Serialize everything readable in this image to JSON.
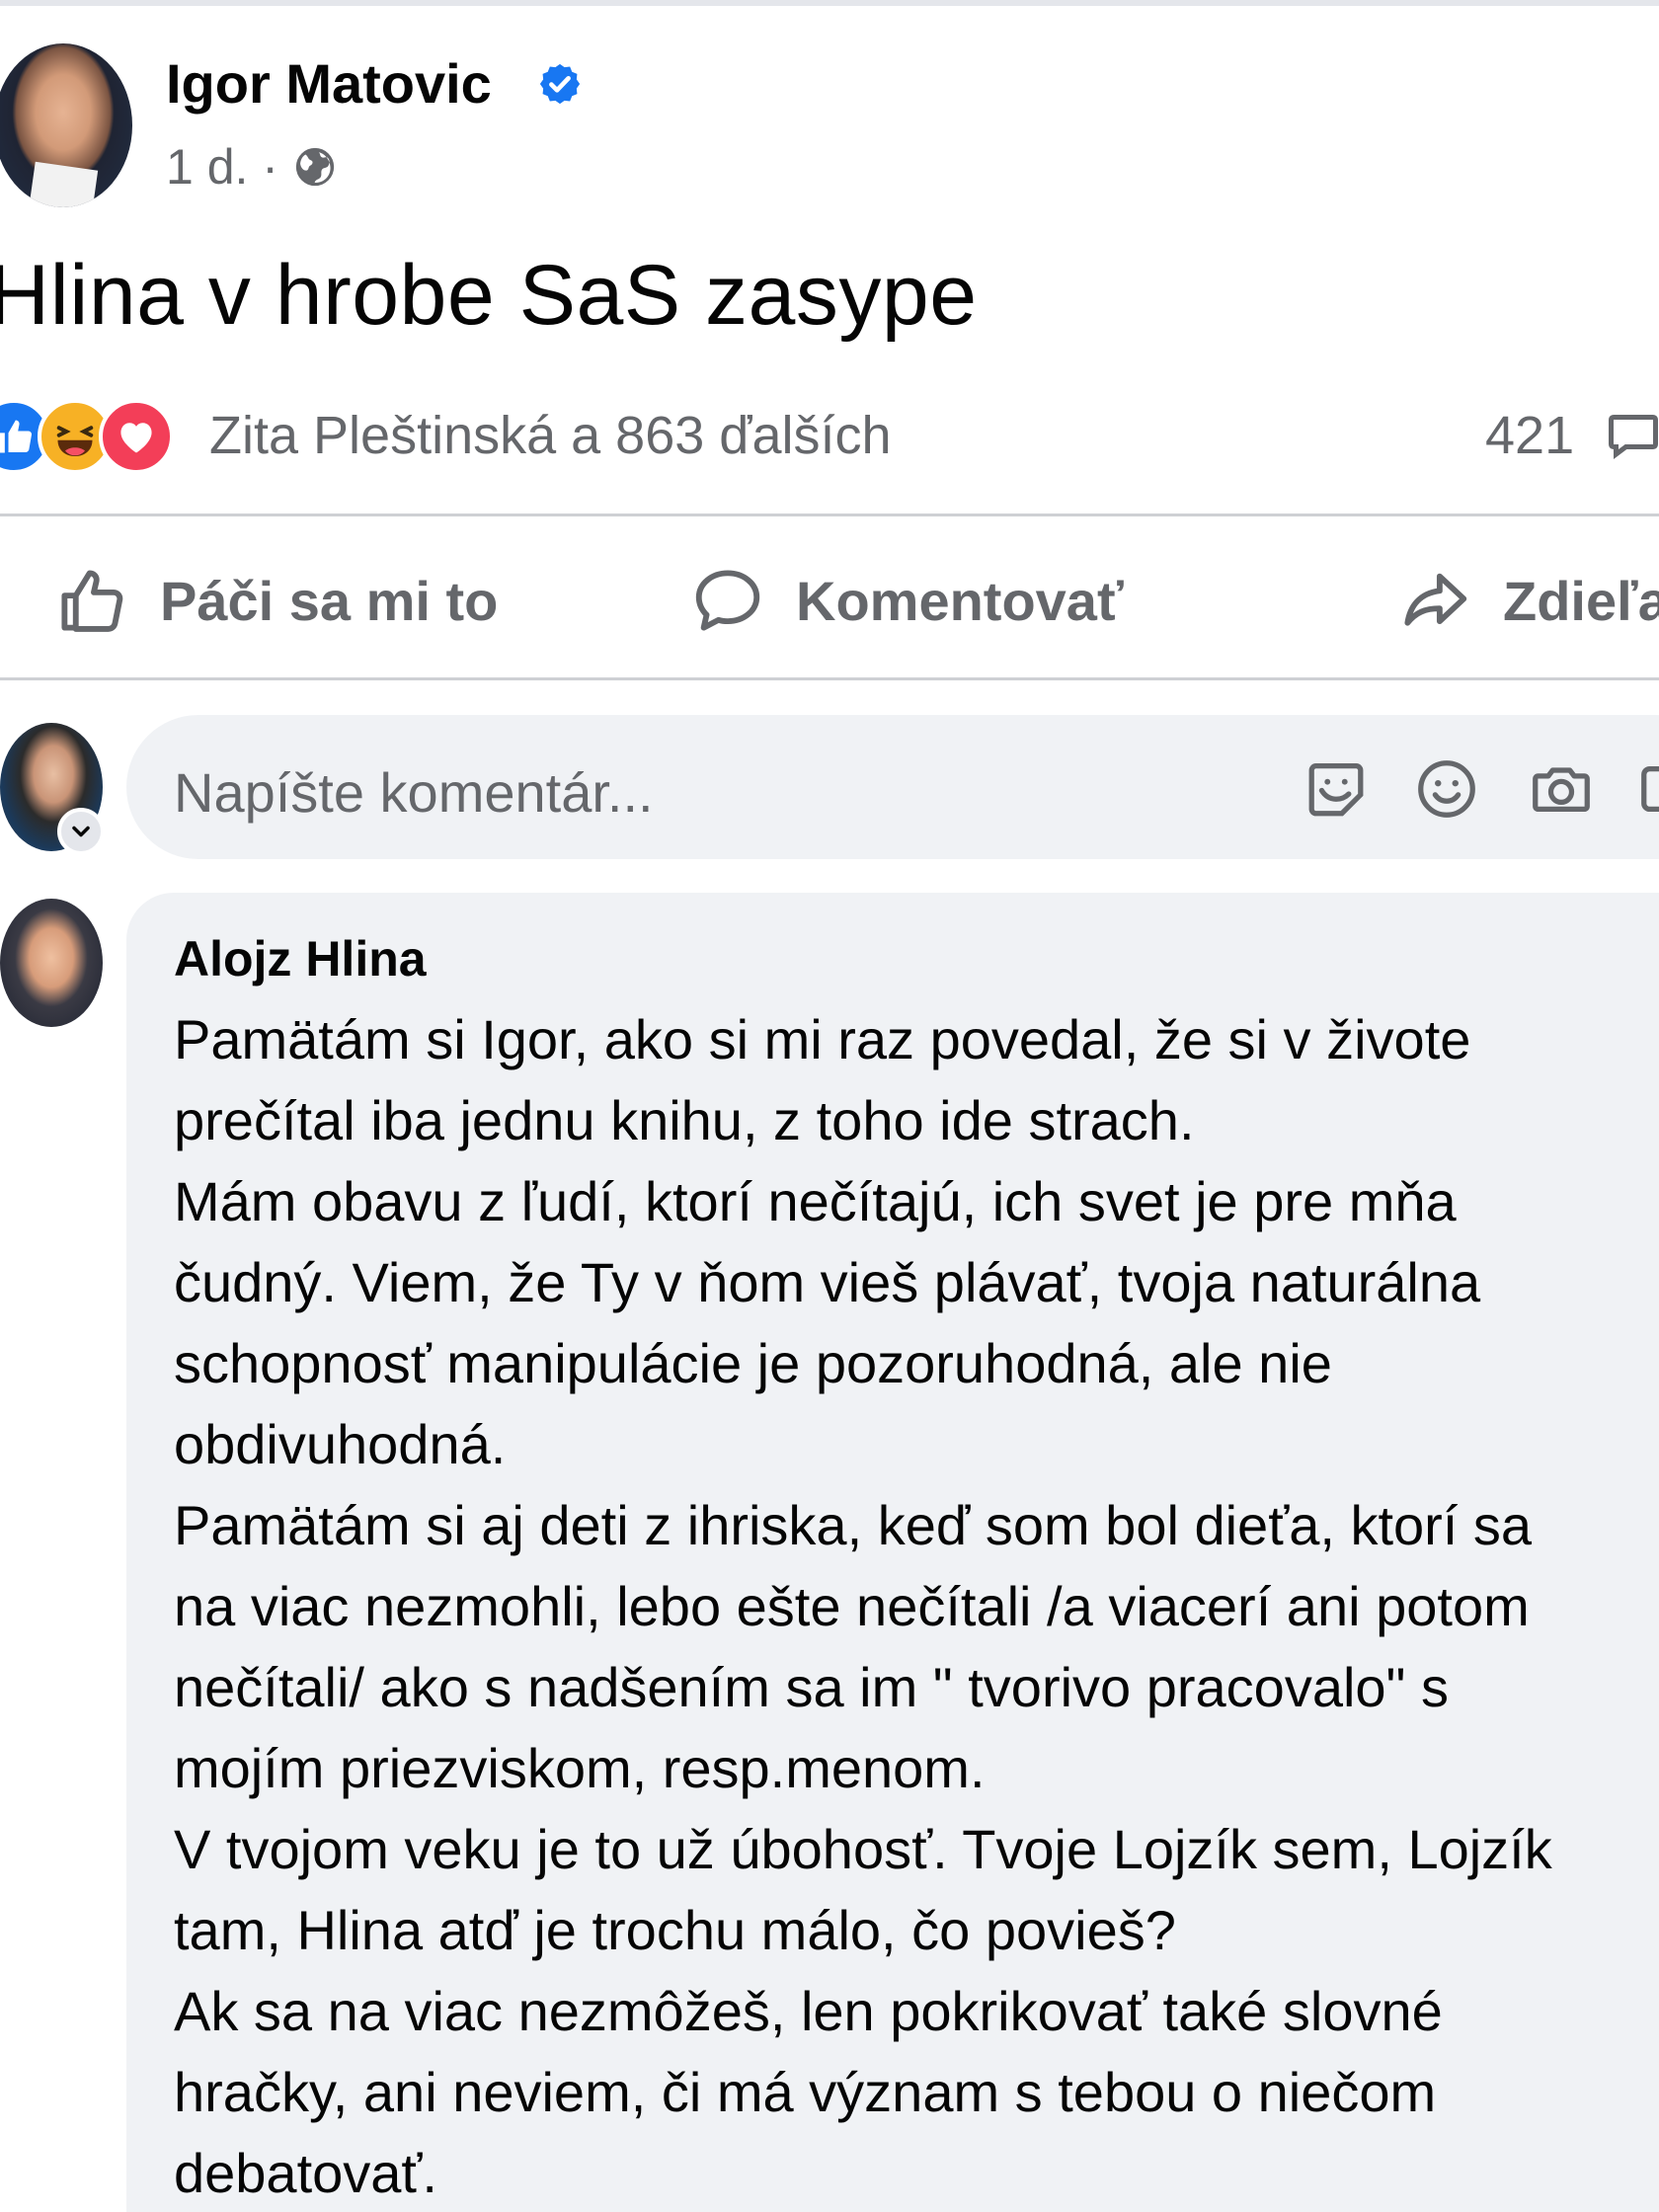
{
  "post": {
    "author": "Igor Matovic",
    "verified": true,
    "time": "1 d. ·",
    "privacy_icon": "globe-icon",
    "text": "Hlina v hrobe SaS zasype"
  },
  "reactions": {
    "types": [
      "like",
      "haha",
      "love"
    ],
    "summary": "Zita Pleštinská a 863 ďalších",
    "comment_count": "421"
  },
  "actions": {
    "like": "Páči sa mi to",
    "comment": "Komentovať",
    "share": "Zdieľa"
  },
  "composer": {
    "placeholder": "Napíšte komentár..."
  },
  "comment": {
    "author": "Alojz Hlina",
    "lines": [
      "Pamätám si Igor, ako si mi raz povedal, že si v živote",
      "prečítal iba jednu knihu, z toho ide strach.",
      "Mám obavu z ľudí, ktorí nečítajú, ich svet je pre mňa",
      "čudný. Viem, že Ty v ňom vieš plávať, tvoja naturálna",
      "schopnosť manipulácie je pozoruhodná, ale nie",
      "obdivuhodná.",
      "Pamätám si aj deti z ihriska, keď som bol dieťa, ktorí sa",
      "na viac nezmohli, lebo ešte nečítali /a viacerí ani potom",
      "nečítali/ ako s nadšením sa im \" tvorivo pracovalo\" s",
      "mojím priezviskom, resp.menom.",
      "V tvojom veku je to už úbohosť. Tvoje Lojzík sem, Lojzík",
      "tam, Hlina atď je trochu málo, čo povieš?",
      "Ak sa na viac nezmôžeš, len pokrikovať také slovné",
      "hračky, ani neviem, či má význam s tebou o niečom",
      "debatovať."
    ]
  },
  "colors": {
    "brand_blue": "#1877f2",
    "haha_yellow": "#f7b125",
    "love_red": "#f33e58",
    "secondary_text": "#65676b",
    "bubble_bg": "#f0f2f5"
  }
}
